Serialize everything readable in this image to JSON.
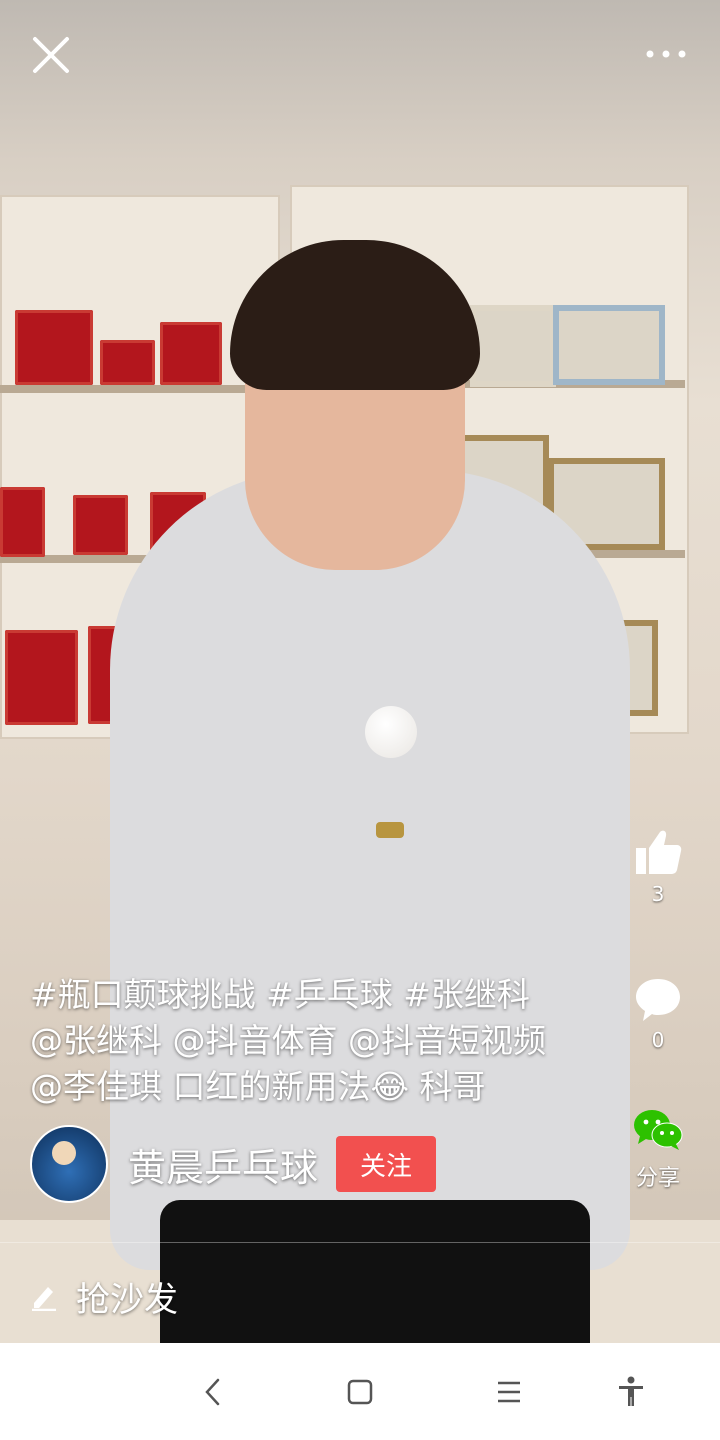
{
  "top_bar": {
    "close_icon": "close-icon",
    "more_icon": "more-icon"
  },
  "side_actions": {
    "like": {
      "icon": "thumbs-up-icon",
      "count": "3"
    },
    "comment": {
      "icon": "comment-bubble-icon",
      "count": "0"
    },
    "share": {
      "icon": "wechat-icon",
      "label": "分享",
      "color": "#2dc100"
    }
  },
  "caption": {
    "line1": "#瓶口颠球挑战 #乒乓球 #张继科",
    "line2": "@张继科 @抖音体育 @抖音短视频",
    "line3_text": "@李佳琪 口红的新用法",
    "line3_emoji": "😂",
    "line3_tail": " 科哥"
  },
  "author": {
    "name": "黄晨乒乓球",
    "follow_label": "关注",
    "follow_color": "#f2504f"
  },
  "comment_bar": {
    "icon": "pencil-icon",
    "label": "抢沙发"
  },
  "system_nav": {
    "back_icon": "back-icon",
    "home_icon": "home-icon",
    "menu_icon": "menu-icon",
    "accessibility_icon": "accessibility-icon"
  }
}
